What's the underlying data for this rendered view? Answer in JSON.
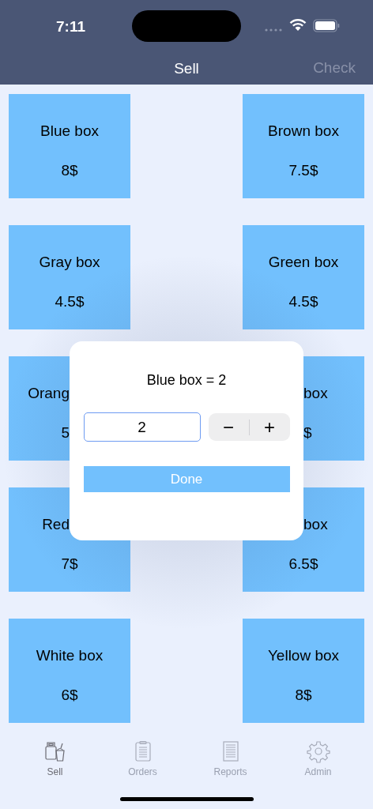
{
  "status_bar": {
    "time": "7:11"
  },
  "nav": {
    "title": "Sell",
    "action": {
      "label": "Check",
      "disabled": true
    }
  },
  "products": [
    {
      "name": "Blue box",
      "price": "8$"
    },
    {
      "name": "Brown box",
      "price": "7.5$"
    },
    {
      "name": "Gray box",
      "price": "4.5$"
    },
    {
      "name": "Green box",
      "price": "4.5$"
    },
    {
      "name": "Orang",
      "price": "5",
      "name_covered": true,
      "price_covered": true
    },
    {
      "name": "box",
      "price": "$",
      "name_covered": true,
      "price_covered": true
    },
    {
      "name": "Red",
      "price": "7$",
      "name_covered": true
    },
    {
      "name": "box",
      "price": "6.5$",
      "name_covered": true
    },
    {
      "name": "White box",
      "price": "6$"
    },
    {
      "name": "Yellow box",
      "price": "8$"
    }
  ],
  "dialog": {
    "title": "Blue box = 2",
    "quantity": "2",
    "decrement": "−",
    "increment": "+",
    "done": "Done"
  },
  "tabs": [
    {
      "label": "Sell",
      "selected": true
    },
    {
      "label": "Orders",
      "selected": false
    },
    {
      "label": "Reports",
      "selected": false
    },
    {
      "label": "Admin",
      "selected": false
    }
  ]
}
